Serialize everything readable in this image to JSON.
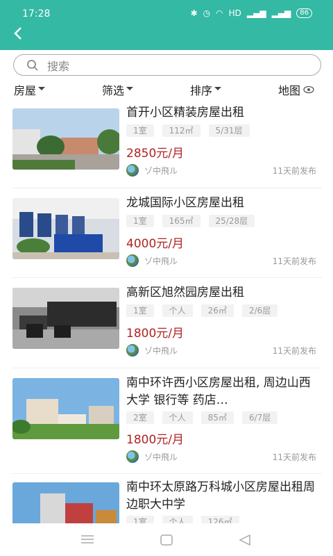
{
  "status_bar": {
    "time": "17:28",
    "icons_text": "HD",
    "battery": "86"
  },
  "search": {
    "placeholder": "搜索"
  },
  "filters": [
    {
      "label": "房屋"
    },
    {
      "label": "筛选"
    },
    {
      "label": "排序"
    },
    {
      "label": "地图"
    }
  ],
  "listings": [
    {
      "title": "首开小区精装房屋出租",
      "tags": [
        "1室",
        "112㎡",
        "5/31层"
      ],
      "price": "2850元/月",
      "author": "ゾ中飛ル",
      "date": "11天前发布"
    },
    {
      "title": "龙城国际小区房屋出租",
      "tags": [
        "1室",
        "165㎡",
        "25/28层"
      ],
      "price": "4000元/月",
      "author": "ゾ中飛ル",
      "date": "11天前发布"
    },
    {
      "title": "高新区旭然园房屋出租",
      "tags": [
        "1室",
        "个人",
        "26㎡",
        "2/6层"
      ],
      "price": "1800元/月",
      "author": "ゾ中飛ル",
      "date": "11天前发布"
    },
    {
      "title": "南中环许西小区房屋出租, 周边山西大学 银行等 药店…",
      "tags": [
        "2室",
        "个人",
        "85㎡",
        "6/7层"
      ],
      "price": "1800元/月",
      "author": "ゾ中飛ル",
      "date": "11天前发布"
    },
    {
      "title": "南中环太原路万科城小区房屋出租周边职大中学",
      "tags": [
        "1室",
        "个人",
        "126㎡"
      ],
      "price": "",
      "author": "",
      "date": ""
    }
  ],
  "colors": {
    "header": "#34b9a4",
    "price": "#b22222"
  }
}
